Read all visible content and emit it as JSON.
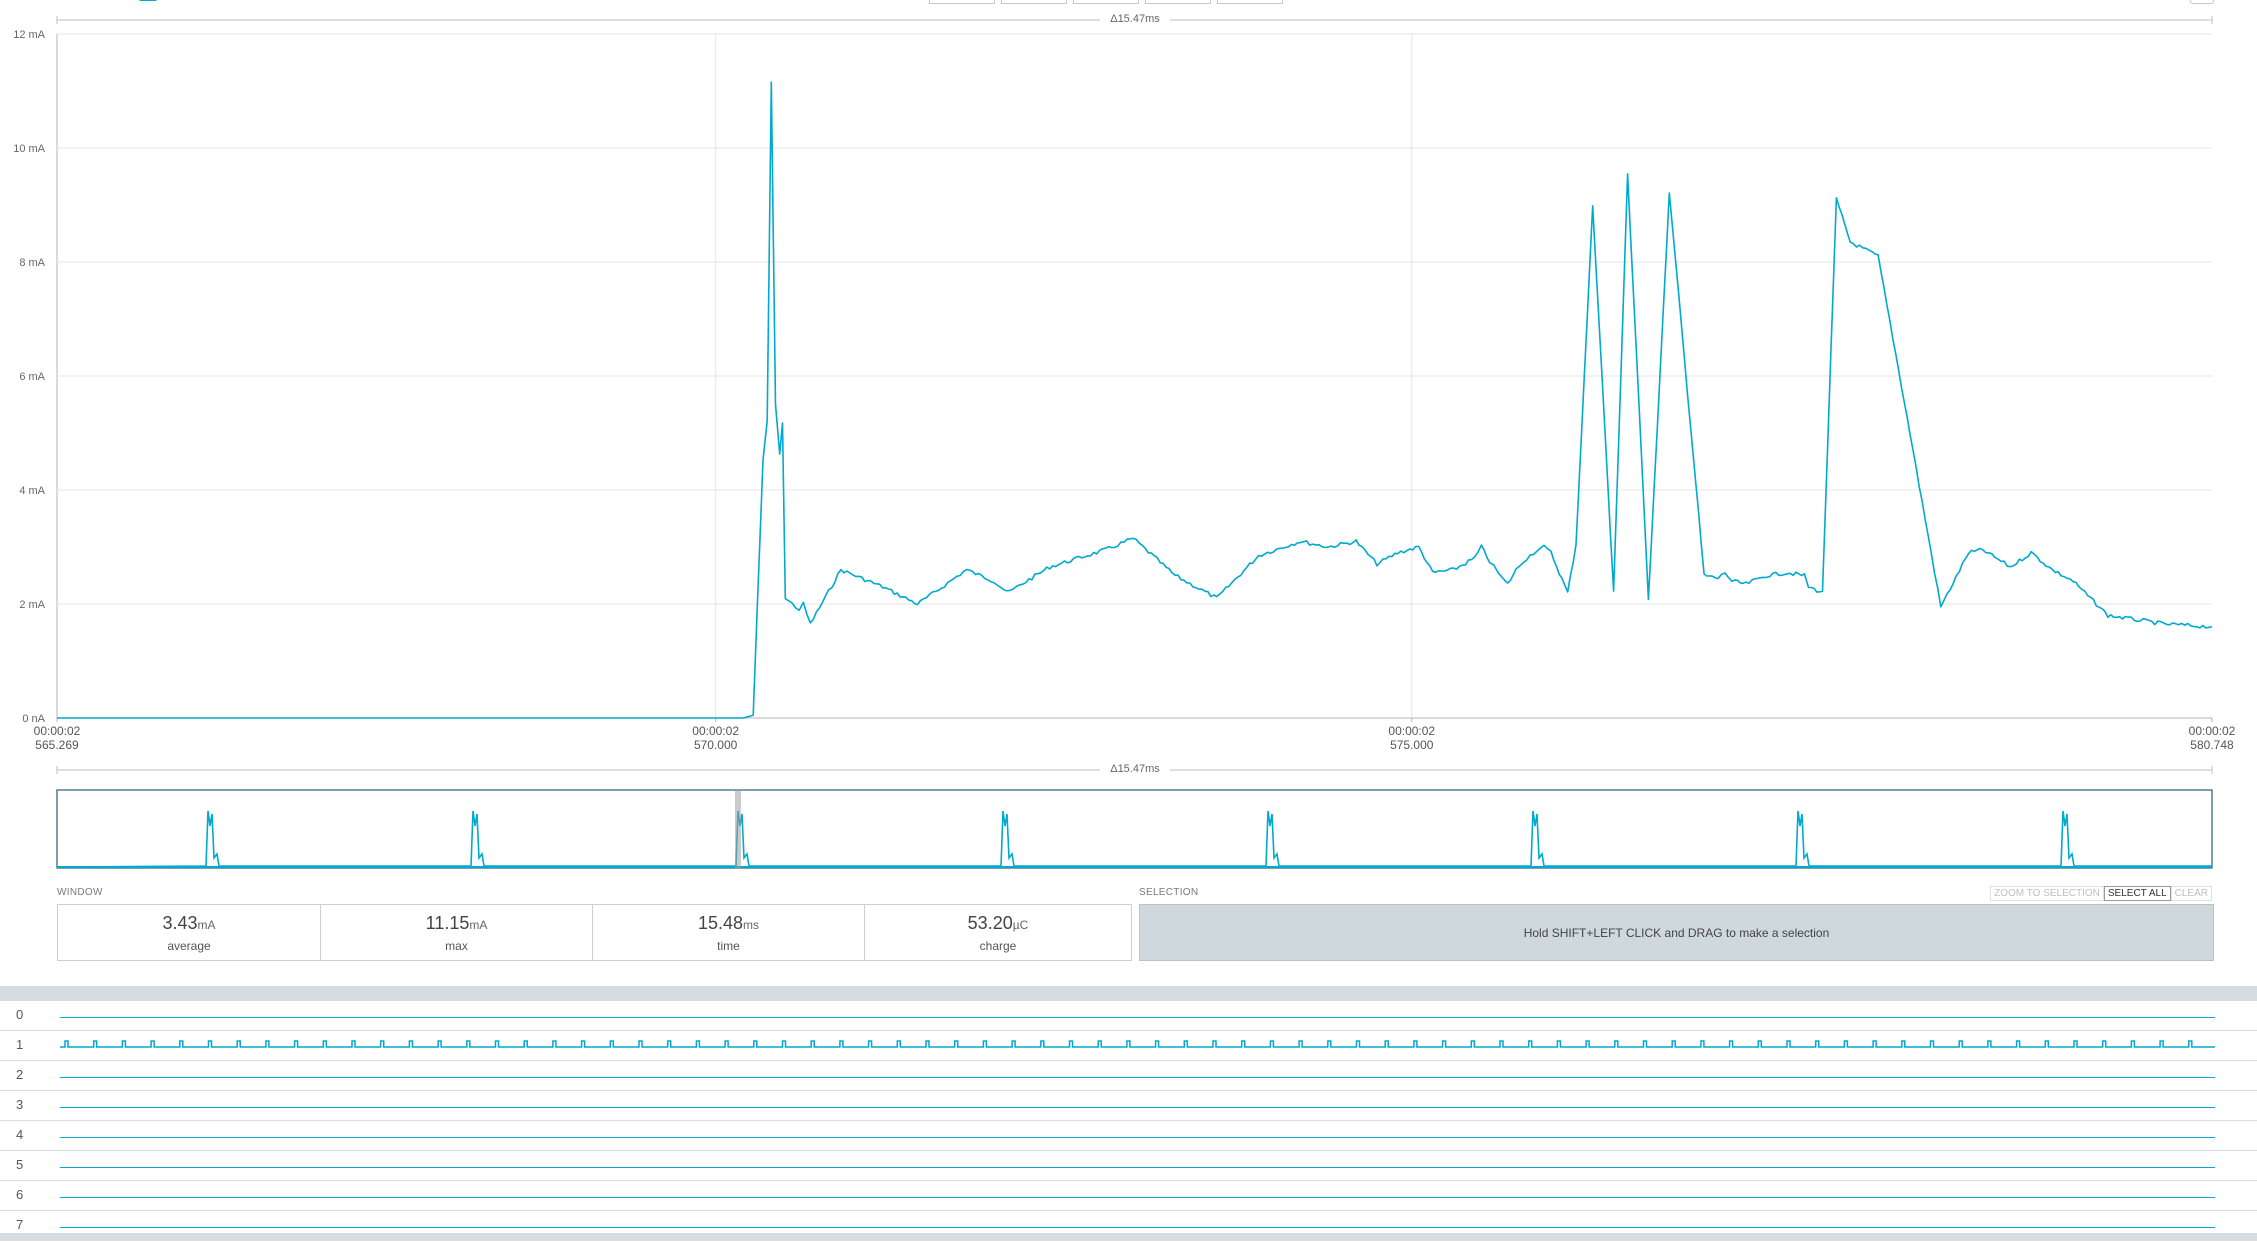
{
  "colors": {
    "trace": "#00a9ce",
    "grid": "#e6e6e6",
    "axis": "#b5b5b5",
    "selection_bg": "#cfd8dd"
  },
  "chart_data": {
    "type": "line",
    "unit": "mA",
    "xlim": [
      565.269,
      580.748
    ],
    "ylim": [
      0,
      12
    ],
    "y_ticks": [
      "0 nA",
      "2 mA",
      "4 mA",
      "6 mA",
      "8 mA",
      "10 mA",
      "12 mA"
    ],
    "x_ticks": [
      {
        "time": "00:00:02",
        "ms": "565.269"
      },
      {
        "time": "00:00:02",
        "ms": "570.000"
      },
      {
        "time": "00:00:02",
        "ms": "575.000"
      },
      {
        "time": "00:00:02",
        "ms": "580.748"
      }
    ],
    "delta_label": "Δ15.47ms",
    "grid": true,
    "series": [
      {
        "x": [
          565.269,
          570.2,
          570.27,
          570.3,
          570.34,
          570.37,
          570.4,
          570.43,
          570.46,
          570.48,
          570.5,
          570.55,
          570.6,
          570.63,
          570.68,
          570.9,
          571.2,
          571.45,
          571.6,
          571.8,
          572.0,
          572.1,
          572.4,
          572.8,
          573.0,
          573.3,
          573.6,
          573.9,
          574.2,
          574.4,
          574.6,
          574.75,
          574.9,
          575.05,
          575.15,
          575.3,
          575.45,
          575.5,
          575.56,
          575.59,
          575.62,
          575.65,
          575.69,
          575.75,
          575.8,
          575.85,
          575.9,
          575.95,
          576.0,
          576.06,
          576.12,
          576.18,
          576.3,
          576.45,
          576.55,
          576.7,
          576.85,
          577.0,
          577.1,
          577.2,
          577.25,
          577.3,
          577.4,
          577.55,
          577.7,
          577.82,
          577.85,
          577.95,
          578.05,
          578.15,
          578.35,
          578.6,
          578.8,
          579.0,
          579.1,
          579.3,
          579.45,
          579.6,
          579.75,
          580.0,
          580.4,
          580.748
        ],
        "values": [
          0,
          0,
          0.05,
          2,
          4.5,
          5.2,
          11.15,
          5.5,
          4.6,
          5.2,
          2.1,
          2.0,
          1.9,
          2.0,
          1.65,
          2.6,
          2.3,
          2.0,
          2.25,
          2.6,
          2.4,
          2.2,
          2.65,
          2.95,
          3.15,
          2.5,
          2.1,
          2.85,
          3.1,
          3.0,
          3.1,
          2.7,
          2.9,
          3.0,
          2.55,
          2.6,
          2.8,
          3.0,
          2.75,
          2.65,
          2.55,
          2.45,
          2.35,
          2.6,
          2.75,
          2.85,
          2.95,
          3.0,
          2.9,
          2.55,
          2.2,
          3.05,
          9.0,
          2.2,
          9.55,
          2.1,
          9.2,
          5.2,
          2.5,
          2.45,
          2.55,
          2.4,
          2.35,
          2.5,
          2.55,
          2.5,
          2.3,
          2.2,
          9.1,
          8.35,
          8.1,
          4.7,
          1.95,
          2.9,
          2.95,
          2.65,
          2.9,
          2.6,
          2.4,
          1.8,
          1.65,
          1.6
        ]
      }
    ]
  },
  "overview": {
    "delta_label": "Δ15.47ms",
    "pulse_count": 8
  },
  "window": {
    "label": "WINDOW",
    "stats": [
      {
        "value": "3.43",
        "unit": "mA",
        "label": "average"
      },
      {
        "value": "11.15",
        "unit": "mA",
        "label": "max"
      },
      {
        "value": "15.48",
        "unit": "ms",
        "label": "time"
      },
      {
        "value": "53.20",
        "unit": "µC",
        "label": "charge"
      }
    ]
  },
  "selection": {
    "label": "SELECTION",
    "zoom_to_selection": "ZOOM TO SELECTION",
    "select_all": "SELECT ALL",
    "clear": "CLEAR",
    "hint": "Hold SHIFT+LEFT CLICK and DRAG to make a selection"
  },
  "digital_channels": [
    {
      "label": "0",
      "toggling": false
    },
    {
      "label": "1",
      "toggling": true
    },
    {
      "label": "2",
      "toggling": false
    },
    {
      "label": "3",
      "toggling": false
    },
    {
      "label": "4",
      "toggling": false
    },
    {
      "label": "5",
      "toggling": false
    },
    {
      "label": "6",
      "toggling": false
    },
    {
      "label": "7",
      "toggling": false
    }
  ]
}
